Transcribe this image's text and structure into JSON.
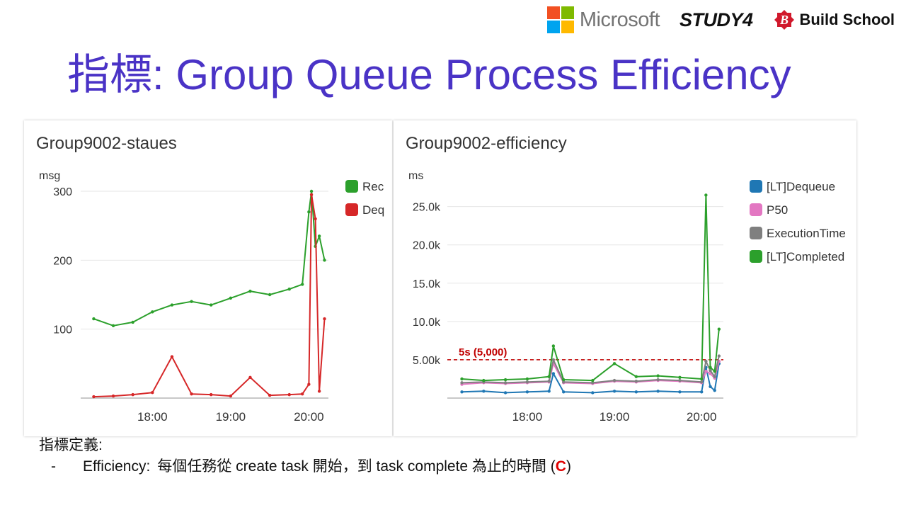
{
  "header": {
    "logos": {
      "microsoft": "Microsoft",
      "study4": "STUDY4",
      "buildschool_mark": "B",
      "buildschool": "Build School"
    },
    "title": "指標: Group Queue Process Efficiency"
  },
  "colors": {
    "title": "#4a33c6",
    "green": "#2ca02c",
    "red": "#d62728",
    "blue": "#1f77b4",
    "pink": "#e377c2",
    "gray": "#7f7f7f",
    "threshold": "#c00000"
  },
  "chart_data": [
    {
      "type": "line",
      "title": "Group9002-staues",
      "ylabel": "msg",
      "ylim": [
        0,
        300
      ],
      "yticks": [
        "300",
        "200",
        "100"
      ],
      "xticks": [
        "18:00",
        "19:00",
        "20:00"
      ],
      "legend_position": "right (truncated)",
      "grid": true,
      "x": [
        "17:15",
        "17:30",
        "17:45",
        "18:00",
        "18:15",
        "18:30",
        "18:45",
        "19:00",
        "19:15",
        "19:30",
        "19:45",
        "19:55",
        "20:00",
        "20:02",
        "20:05",
        "20:08",
        "20:12"
      ],
      "series": [
        {
          "name": "Rec",
          "color": "green",
          "values": [
            115,
            105,
            110,
            125,
            135,
            140,
            135,
            145,
            155,
            150,
            158,
            165,
            270,
            300,
            220,
            235,
            200
          ]
        },
        {
          "name": "Deq",
          "color": "red",
          "values": [
            2,
            3,
            5,
            8,
            60,
            6,
            5,
            3,
            30,
            4,
            5,
            6,
            20,
            295,
            260,
            10,
            115
          ]
        }
      ]
    },
    {
      "type": "line",
      "title": "Group9002-efficiency",
      "ylabel": "ms",
      "ylim": [
        0,
        27000
      ],
      "yticks": [
        "25.0k",
        "20.0k",
        "15.0k",
        "10.0k",
        "5.00k"
      ],
      "xticks": [
        "18:00",
        "19:00",
        "20:00"
      ],
      "legend_position": "right",
      "grid": true,
      "threshold": {
        "value": 5000,
        "label": "5s (5,000)"
      },
      "x": [
        "17:15",
        "17:30",
        "17:45",
        "18:00",
        "18:15",
        "18:18",
        "18:25",
        "18:45",
        "19:00",
        "19:15",
        "19:30",
        "19:45",
        "20:00",
        "20:03",
        "20:06",
        "20:09",
        "20:12"
      ],
      "series": [
        {
          "name": "[LT]Dequeue",
          "color": "blue",
          "values": [
            800,
            900,
            700,
            800,
            900,
            3200,
            800,
            700,
            900,
            800,
            900,
            800,
            800,
            4000,
            1500,
            1000,
            4500
          ]
        },
        {
          "name": "P50",
          "color": "pink",
          "values": [
            1800,
            2000,
            1900,
            2000,
            2100,
            4500,
            2000,
            1900,
            2200,
            2100,
            2300,
            2200,
            2000,
            3500,
            3200,
            2600,
            4800
          ]
        },
        {
          "name": "ExecutionTime",
          "color": "gray",
          "values": [
            2000,
            2100,
            2000,
            2100,
            2200,
            5000,
            2100,
            2000,
            2300,
            2200,
            2400,
            2300,
            2100,
            4800,
            3600,
            2800,
            5500
          ]
        },
        {
          "name": "[LT]Completed",
          "color": "green",
          "values": [
            2500,
            2300,
            2400,
            2500,
            2800,
            6800,
            2400,
            2300,
            4500,
            2800,
            2900,
            2700,
            2500,
            26500,
            4000,
            3500,
            9000
          ]
        }
      ]
    }
  ],
  "footer": {
    "definition_title": "指標定義:",
    "bullet": "-",
    "efficiency_key": "Efficiency:",
    "efficiency_text_before": "每個任務從 create task 開始，到 task complete 為止的時間 (",
    "efficiency_letter": "C",
    "efficiency_text_after": ")"
  }
}
